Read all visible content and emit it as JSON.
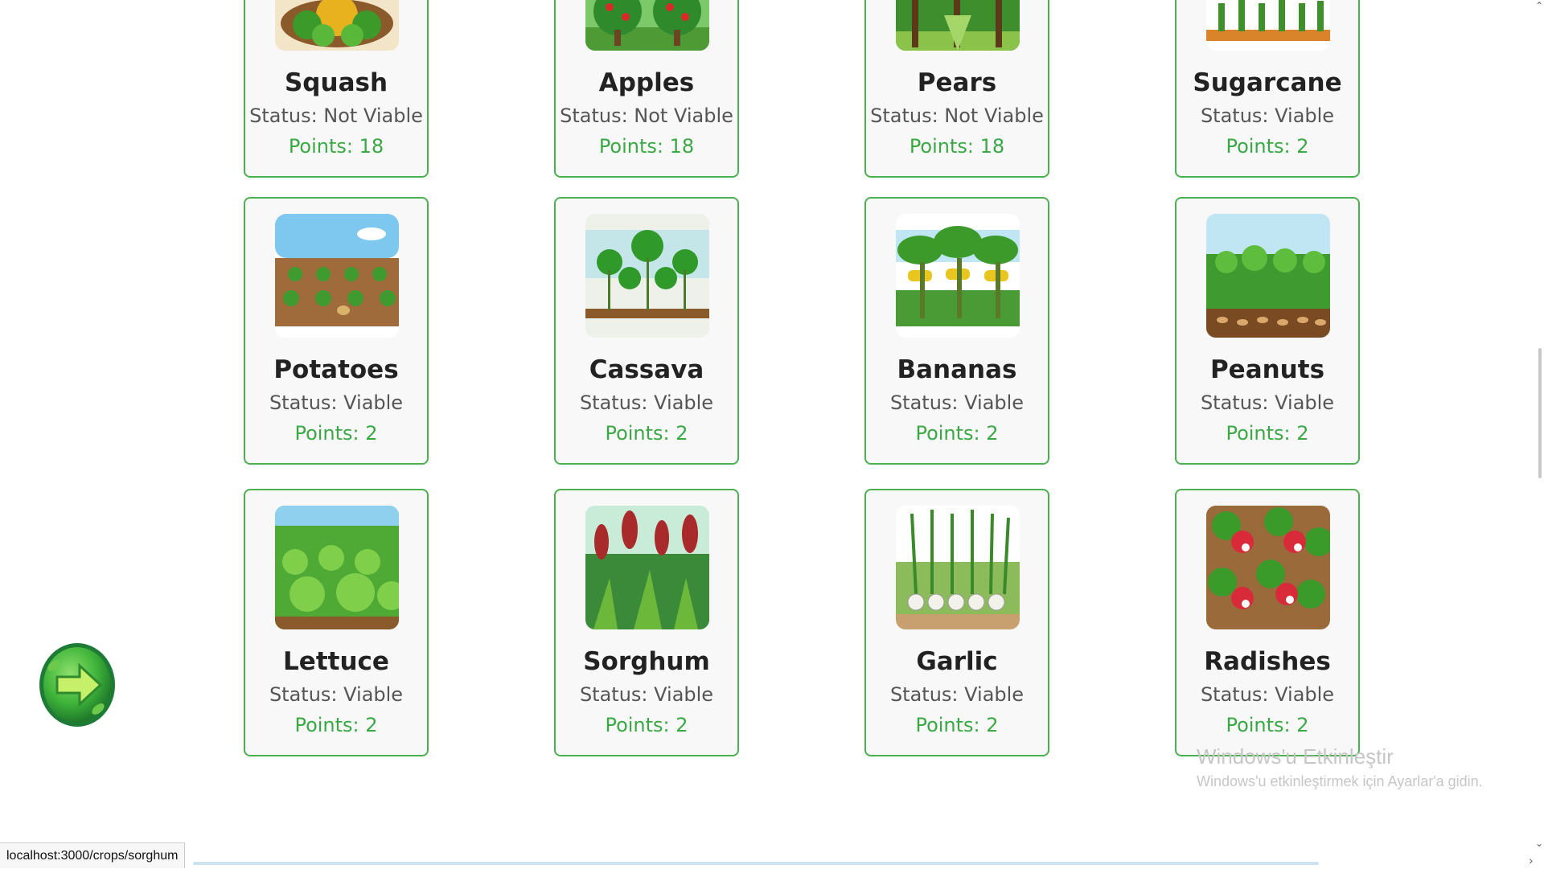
{
  "cards": [
    {
      "name": "Squash",
      "status": "Status: Not Viable",
      "points": "Points: 18",
      "icon": "squash-image"
    },
    {
      "name": "Apples",
      "status": "Status: Not Viable",
      "points": "Points: 18",
      "icon": "apples-image"
    },
    {
      "name": "Pears",
      "status": "Status: Not Viable",
      "points": "Points: 18",
      "icon": "pears-image"
    },
    {
      "name": "Sugarcane",
      "status": "Status: Viable",
      "points": "Points: 2",
      "icon": "sugarcane-image"
    },
    {
      "name": "Potatoes",
      "status": "Status: Viable",
      "points": "Points: 2",
      "icon": "potatoes-image"
    },
    {
      "name": "Cassava",
      "status": "Status: Viable",
      "points": "Points: 2",
      "icon": "cassava-image"
    },
    {
      "name": "Bananas",
      "status": "Status: Viable",
      "points": "Points: 2",
      "icon": "bananas-image"
    },
    {
      "name": "Peanuts",
      "status": "Status: Viable",
      "points": "Points: 2",
      "icon": "peanuts-image"
    },
    {
      "name": "Lettuce",
      "status": "Status: Viable",
      "points": "Points: 2",
      "icon": "lettuce-image"
    },
    {
      "name": "Sorghum",
      "status": "Status: Viable",
      "points": "Points: 2",
      "icon": "sorghum-image"
    },
    {
      "name": "Garlic",
      "status": "Status: Viable",
      "points": "Points: 2",
      "icon": "garlic-image"
    },
    {
      "name": "Radishes",
      "status": "Status: Viable",
      "points": "Points: 2",
      "icon": "radishes-image"
    }
  ],
  "next_button": {
    "icon": "arrow-right-icon"
  },
  "statusbar": {
    "url": "localhost:3000/crops/sorghum"
  },
  "watermark": {
    "title": "Windows'u Etkinleştir",
    "subtitle": "Windows'u etkinleştirmek için Ayarlar'a gidin."
  },
  "colors": {
    "accent": "#4caf50",
    "points": "#3aa845"
  }
}
